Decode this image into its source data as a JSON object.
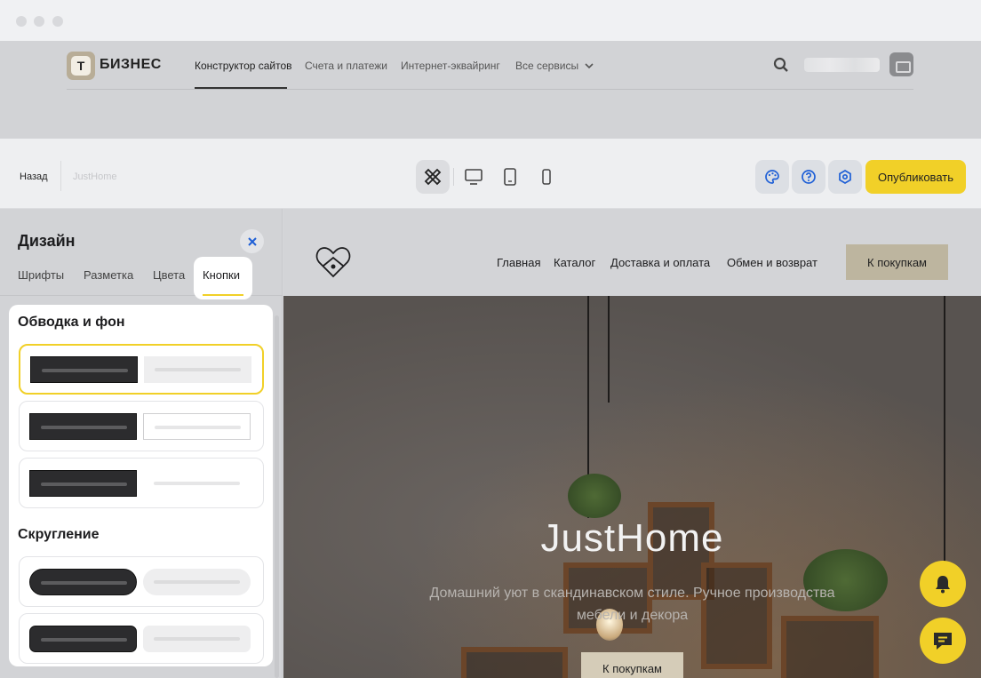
{
  "header": {
    "logo_letter": "Т",
    "brand": "БИЗНЕС",
    "nav": [
      "Конструктор сайтов",
      "Счета и платежи",
      "Интернет-эквайринг",
      "Все сервисы"
    ]
  },
  "toolbar": {
    "back": "Назад",
    "site_name": "JustHome",
    "publish": "Опубликовать"
  },
  "panel": {
    "title": "Дизайн",
    "tabs": [
      "Шрифты",
      "Разметка",
      "Цвета",
      "Кнопки"
    ],
    "active_tab": "Кнопки",
    "section_outline": "Обводка и фон",
    "section_rounding": "Скругление"
  },
  "preview": {
    "nav": [
      "Главная",
      "Каталог",
      "Доставка и оплата",
      "Обмен и возврат"
    ],
    "cta": "К покупкам",
    "hero_title": "JustHome",
    "hero_subtitle": "Домашний уют в скандинавском стиле. Ручное производства мебели и декора",
    "hero_button": "К покупкам"
  },
  "colors": {
    "accent": "#f1d028",
    "brand_button": "#bdb59f"
  },
  "icons": [
    "search-icon",
    "design-tools-icon",
    "desktop-icon",
    "tablet-icon",
    "mobile-icon",
    "palette-icon",
    "help-icon",
    "settings-icon",
    "close-icon",
    "bell-icon",
    "chat-icon",
    "chevron-down-icon"
  ]
}
